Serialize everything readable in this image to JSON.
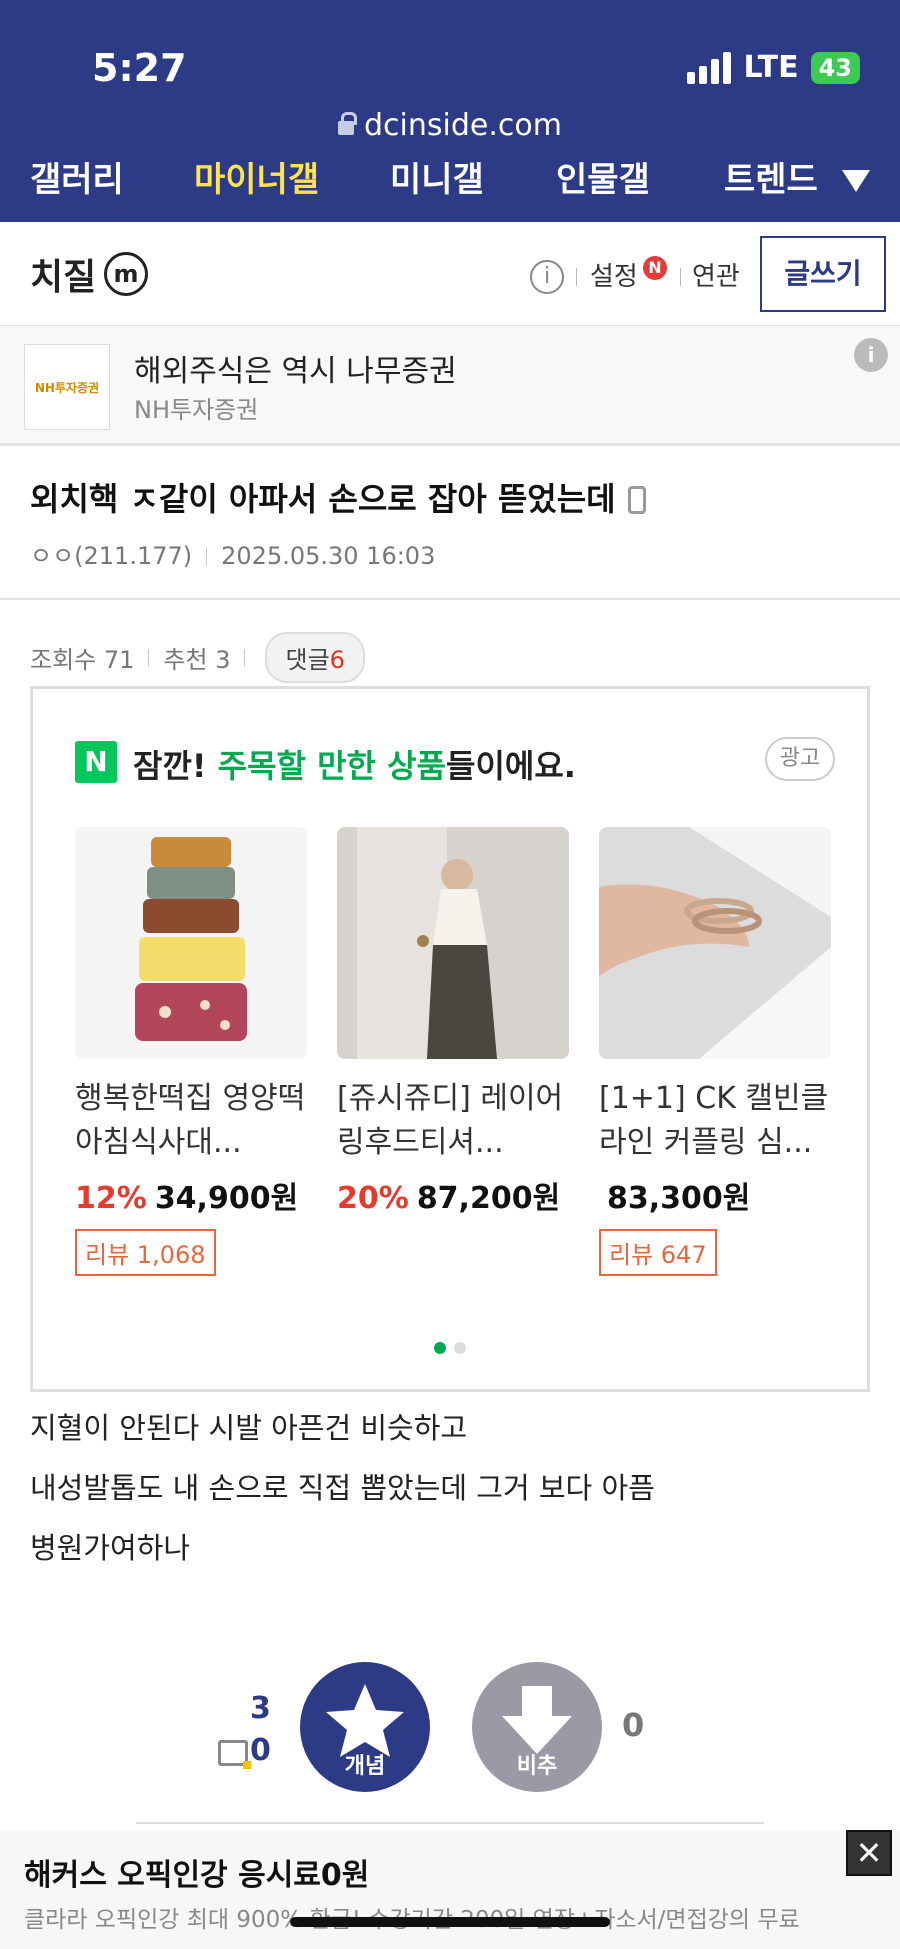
{
  "status": {
    "time": "5:27",
    "network": "LTE",
    "battery": "43"
  },
  "browser": {
    "url": "dcinside.com"
  },
  "nav": {
    "items": [
      "갤러리",
      "마이너갤",
      "미니갤",
      "인물갤",
      "트렌드"
    ]
  },
  "gallery": {
    "name": "치질",
    "badge": "m",
    "settings": "설정",
    "new_badge": "N",
    "related": "연관",
    "write": "글쓰기"
  },
  "top_ad": {
    "logo": "NH투자증권",
    "title": "해외주식은 역시 나무증권",
    "sub": "NH투자증권",
    "info": "i"
  },
  "post": {
    "title": "외치핵 ㅈ같이 아파서 손으로 잡아 뜯었는데",
    "author": "ㅇㅇ(211.177)",
    "date": "2025.05.30 16:03",
    "views_label": "조회수 71",
    "recommend_label": "추천 3",
    "comment_label": "댓글",
    "comment_count": "6",
    "body": [
      "지혈이 안된다 시발 아픈건 비슷하고",
      "내성발톱도 내 손으로 직접 뽑았는데 그거 보다 아픔",
      "병원가여하나"
    ]
  },
  "product_ad": {
    "n_logo": "N",
    "head_prefix": "잠깐! ",
    "head_green": "주목할 만한 상품",
    "head_suffix": "들이에요.",
    "ad_tag": "광고",
    "products": [
      {
        "name": "행복한떡집 영양떡 아침식사대...",
        "discount": "12%",
        "price": "34,900원",
        "review": "리뷰 1,068"
      },
      {
        "name": "[쥬시쥬디] 레이어링후드티셔...",
        "discount": "20%",
        "price": "87,200원",
        "review": ""
      },
      {
        "name": "[1+1] CK 캘빈클라인 커플링 심...",
        "discount": "",
        "price": "83,300원",
        "review": "리뷰 647"
      }
    ]
  },
  "vote": {
    "up_label": "개념",
    "down_label": "비추",
    "up_total": "3",
    "up_mobile": "0",
    "down_count": "0"
  },
  "bottom_ad": {
    "title": "해커스 오픽인강 응시료0원",
    "sub": "클라라 오픽인강 최대 900% 환급! 수강기간 200일 연장+자소서/면접강의 무료",
    "close": "✕"
  },
  "colors": {
    "primary": "#2d3b87",
    "nav_active": "#ffe34f",
    "green": "#03a94f",
    "discount": "#e53b2e",
    "review": "#e9673d"
  }
}
